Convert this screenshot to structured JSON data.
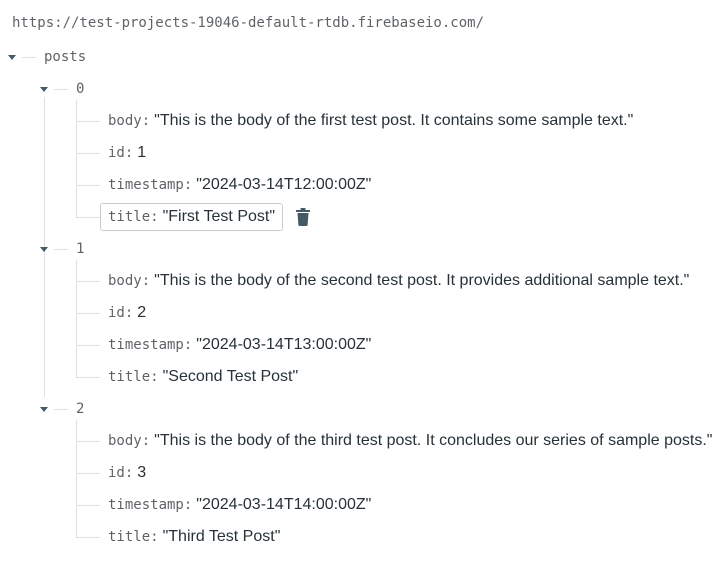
{
  "db_url": "https://test-projects-19046-default-rtdb.firebaseio.com/",
  "root": {
    "key": "posts"
  },
  "posts": [
    {
      "key": "0",
      "fields": [
        {
          "k": "body",
          "v": "\"This is the body of the first test post. It contains some sample text.\""
        },
        {
          "k": "id",
          "v": "1"
        },
        {
          "k": "timestamp",
          "v": "\"2024-03-14T12:00:00Z\""
        },
        {
          "k": "title",
          "v": "\"First Test Post\""
        }
      ]
    },
    {
      "key": "1",
      "fields": [
        {
          "k": "body",
          "v": "\"This is the body of the second test post. It provides additional sample text.\""
        },
        {
          "k": "id",
          "v": "2"
        },
        {
          "k": "timestamp",
          "v": "\"2024-03-14T13:00:00Z\""
        },
        {
          "k": "title",
          "v": "\"Second Test Post\""
        }
      ]
    },
    {
      "key": "2",
      "fields": [
        {
          "k": "body",
          "v": "\"This is the body of the third test post. It concludes our series of sample posts.\""
        },
        {
          "k": "id",
          "v": "3"
        },
        {
          "k": "timestamp",
          "v": "\"2024-03-14T14:00:00Z\""
        },
        {
          "k": "title",
          "v": "\"Third Test Post\""
        }
      ]
    }
  ],
  "separator": ":",
  "icons": {
    "expand": "chevron-down-icon",
    "delete": "trash-icon"
  },
  "colors": {
    "key_text": "#5f6368",
    "value_text": "#263238",
    "tree_line": "#dfe1e5",
    "icon": "#455a64"
  }
}
